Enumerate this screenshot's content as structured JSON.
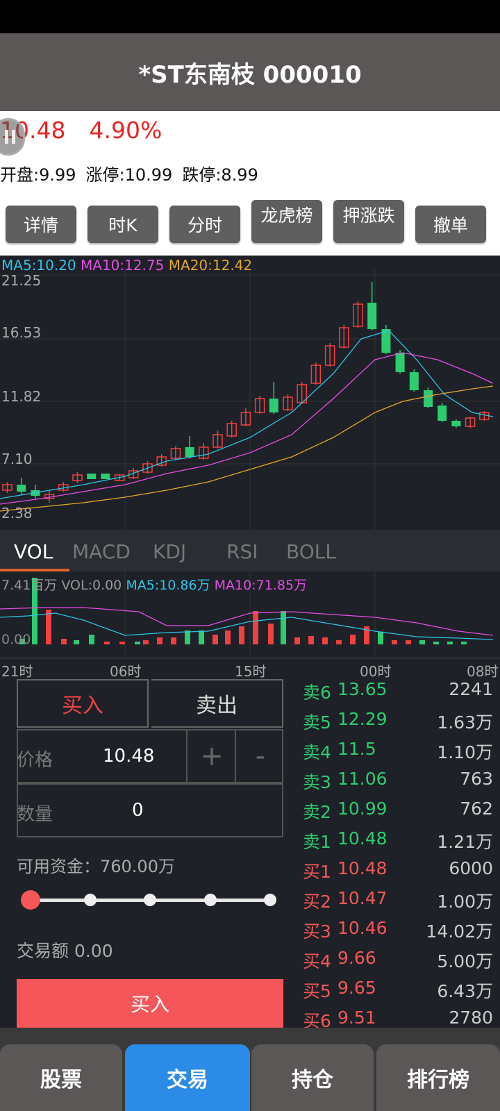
{
  "title": "*ST东南枝 000010",
  "quote": {
    "price": "10.48",
    "change_pct": "4.90%",
    "open": "开盘:9.99",
    "limit_up": "涨停:10.99",
    "limit_down": "跌停:8.99"
  },
  "toolbar": [
    "详情",
    "时K",
    "分时",
    "龙虎榜",
    "押涨跌",
    "撤单"
  ],
  "kline": {
    "ma5": "MA5:10.20",
    "ma10": "MA10:12.75",
    "ma20": "MA20:12.42",
    "y_ticks": [
      "21.25",
      "16.53",
      "11.82",
      "7.10",
      "2.38"
    ],
    "colors": {
      "ma5": "#2ec4e6",
      "ma10": "#e64ee6",
      "ma20": "#e6a72e",
      "up": "#f04040",
      "down": "#2ecc71"
    }
  },
  "indicator_tabs": [
    "VOL",
    "MACD",
    "KDJ",
    "RSI",
    "BOLL"
  ],
  "vol": {
    "unit": "7.41百万",
    "vol": "VOL:0.00",
    "ma5": "MA5:10.86万",
    "ma10": "MA10:71.85万",
    "zero": "0.00",
    "x_ticks": [
      "21时",
      "06时",
      "15时",
      "00时",
      "08时"
    ]
  },
  "trade": {
    "buy_tab": "买入",
    "sell_tab": "卖出",
    "price_label": "价格",
    "price_value": "10.48",
    "plus": "+",
    "minus": "-",
    "qty_label": "数量",
    "qty_value": "0",
    "funds": "可用资金：760.00万",
    "amount": "交易额 0.00",
    "buy_button": "买入"
  },
  "orderbook": [
    {
      "label": "卖6",
      "price": "13.65",
      "vol": "2241",
      "side": "sell"
    },
    {
      "label": "卖5",
      "price": "12.29",
      "vol": "1.63万",
      "side": "sell"
    },
    {
      "label": "卖4",
      "price": "11.5",
      "vol": "1.10万",
      "side": "sell"
    },
    {
      "label": "卖3",
      "price": "11.06",
      "vol": "763",
      "side": "sell"
    },
    {
      "label": "卖2",
      "price": "10.99",
      "vol": "762",
      "side": "sell"
    },
    {
      "label": "卖1",
      "price": "10.48",
      "vol": "1.21万",
      "side": "sell"
    },
    {
      "label": "买1",
      "price": "10.48",
      "vol": "6000",
      "side": "buy"
    },
    {
      "label": "买2",
      "price": "10.47",
      "vol": "1.00万",
      "side": "buy"
    },
    {
      "label": "买3",
      "price": "10.46",
      "vol": "14.02万",
      "side": "buy"
    },
    {
      "label": "买4",
      "price": "9.66",
      "vol": "5.00万",
      "side": "buy"
    },
    {
      "label": "买5",
      "price": "9.65",
      "vol": "6.43万",
      "side": "buy"
    },
    {
      "label": "买6",
      "price": "9.51",
      "vol": "2780",
      "side": "buy"
    }
  ],
  "nav": [
    "股票",
    "交易",
    "持仓",
    "排行榜"
  ],
  "nav_active": "交易"
}
